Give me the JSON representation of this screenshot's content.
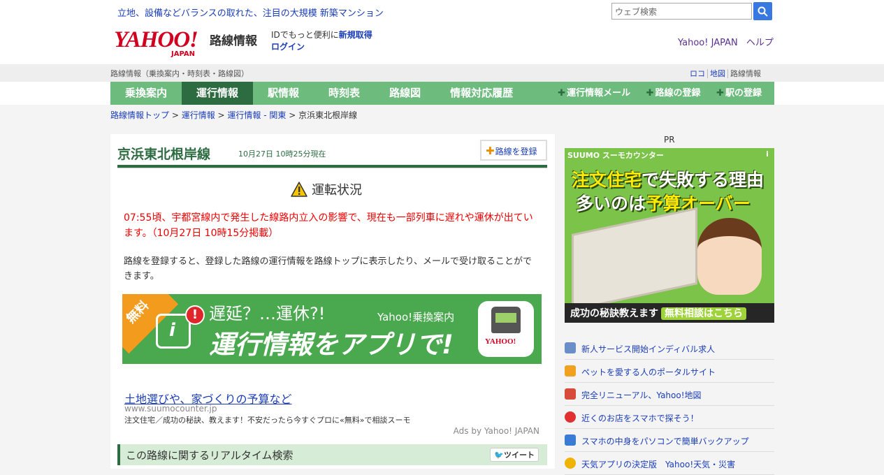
{
  "top_ad": {
    "text": "立地、設備などバランスの取れた、注目の大規模 新築マンション"
  },
  "search": {
    "placeholder": "ウェブ検索"
  },
  "header": {
    "logo": "YAHOO!",
    "logo_sub": "JAPAN",
    "service": "路線情報",
    "id_text": "IDでもっと便利に",
    "id_link": "新規取得",
    "login": "ログイン",
    "links": [
      "Yahoo! JAPAN",
      "ヘルプ"
    ]
  },
  "subbar": {
    "left": "路線情報（乗換案内・時刻表・路線図）",
    "right": [
      "ロコ",
      "地図",
      "路線情報"
    ]
  },
  "nav": {
    "items": [
      "乗換案内",
      "運行情報",
      "駅情報",
      "時刻表",
      "路線図",
      "情報対応履歴"
    ],
    "active_index": 1,
    "right_items": [
      "運行情報メール",
      "路線の登録",
      "駅の登録"
    ]
  },
  "breadcrumb": [
    "路線情報トップ",
    "運行情報",
    "運行情報 - 関東",
    "京浜東北根岸線"
  ],
  "main": {
    "line_title": "京浜東北根岸線",
    "date": "10月27日 10時25分現在",
    "register_button": "路線を登録",
    "status_title": "運転状況",
    "alert": "07:55頃、宇都宮線内で発生した線路内立入の影響で、現在も一部列車に遅れや運休が出ています。（10月27日 10時15分掲載）",
    "info": "路線を登録すると、登録した路線の運行情報を路線トップに表示したり、メールで受け取ることができます。",
    "banner": {
      "badge": "無料",
      "line1": "遅延？…運休?!",
      "line2": "運行情報をアプリで!",
      "app": "Yahoo!乗換案内",
      "icon_text": "YAHOO!"
    },
    "ad": {
      "title": "土地選びや、家づくりの予算など",
      "url": "www.suumocounter.jp",
      "text": "注文住宅／成功の秘訣、教えます！不安だったら今すぐプロに«無料»で相談スーモ",
      "by": "Ads by Yahoo! JAPAN"
    },
    "realtime_title": "この路線に関するリアルタイム検索",
    "tweet": "ツイート"
  },
  "right": {
    "pr": "PR",
    "ad": {
      "brand": "SUUMO スーモカウンター",
      "line1a": "注文住宅",
      "line1b": "で失敗する理由",
      "line2a": "多いのは",
      "line2b": "予算オーバー",
      "foot": "成功の秘訣教えます",
      "foot_btn": "無料相談はこちら"
    },
    "links": [
      {
        "text": "新人サービス開始インディバル求人",
        "icon": "doc-icon",
        "color": "#6a8fc8"
      },
      {
        "text": "ペットを愛する人のポータルサイト",
        "icon": "paw-icon",
        "color": "#f2a020"
      },
      {
        "text": "完全リニューアル、Yahoo!地図",
        "icon": "map-icon",
        "color": "#d84a3a"
      },
      {
        "text": "近くのお店をスマホで探そう！",
        "icon": "pin-icon",
        "color": "#e03030"
      },
      {
        "text": "スマホの中身をパソコンで簡単バックアップ",
        "icon": "sync-icon",
        "color": "#3a7bd5"
      },
      {
        "text": "天気アプリの決定版　Yahoo!天気・災害",
        "icon": "weather-icon",
        "color": "#f0b400"
      }
    ]
  }
}
